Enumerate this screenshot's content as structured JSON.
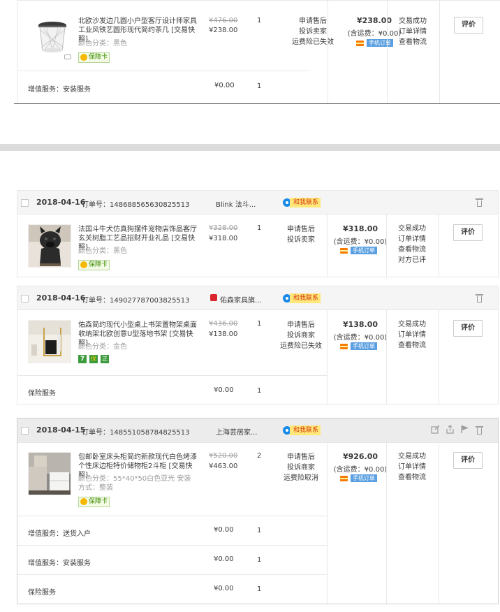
{
  "orders": [
    {
      "product": {
        "title": "北欧沙发边几圆小户型客厅设计师家具工业风铁艺圆形现代简约茶几 [交易快照]",
        "attr": "颜色分类：黑色",
        "badge": "保障卡",
        "orig_price": "¥476.00",
        "price": "¥238.00",
        "qty": "1",
        "actions": [
          "申请售后",
          "投诉卖家",
          "运费险已失效"
        ]
      },
      "total": "¥238.00",
      "shipping": "(含运费：¥0.00)",
      "mobile_tag": "手机订单",
      "status": [
        "交易成功",
        "订单详情",
        "查看物流"
      ],
      "button": "评价",
      "services": [
        {
          "label": "增值服务：安装服务",
          "price": "¥0.00",
          "qty": "1"
        }
      ]
    },
    {
      "date": "2018-04-16",
      "order_no": "订单号：148688565630825513",
      "shop": "Blink 法斗...",
      "contact": "和我联系",
      "product": {
        "title": "法国斗牛犬仿真狗摆件宠物店饰品客厅玄关树脂工艺品招财开业礼品 [交易快照]",
        "attr": "颜色分类：黑色",
        "badge": "保障卡",
        "orig_price": "¥328.00",
        "price": "¥318.00",
        "qty": "1",
        "actions": [
          "申请售后",
          "投诉卖家"
        ]
      },
      "total": "¥318.00",
      "shipping": "(含运费：¥0.00)",
      "mobile_tag": "手机订单",
      "status": [
        "交易成功",
        "订单详情",
        "查看物流",
        "对方已评"
      ],
      "button": "评价"
    },
    {
      "date": "2018-04-16",
      "order_no": "订单号：149027787003825513",
      "shop": "佑森家具旗...",
      "contact": "和我联系",
      "product": {
        "title": "佑森简约现代小型桌上书架置物架桌面收纳架北欧创意U型落地书架 [交易快照]",
        "attr": "颜色分类：金色",
        "badges": [
          "7",
          "保",
          "正"
        ],
        "orig_price": "¥436.00",
        "price": "¥138.00",
        "qty": "1",
        "actions": [
          "申请售后",
          "投诉商家",
          "运费险已失效"
        ]
      },
      "total": "¥138.00",
      "shipping": "(含运费：¥0.00)",
      "mobile_tag": "手机订单",
      "status": [
        "交易成功",
        "订单详情",
        "查看物流"
      ],
      "button": "评价",
      "services": [
        {
          "label": "保险服务",
          "price": "¥0.00",
          "qty": "1"
        }
      ]
    },
    {
      "date": "2018-04-15",
      "order_no": "订单号：148551058784825513",
      "shop": "上海芸居家...",
      "contact": "和我联系",
      "product": {
        "title": "包邮卧室床头柜简约新款现代白色烤漆个性床边柜特价储物柜2斗柜 [交易快照]",
        "attr": "颜色分类：55*40*50白色亚光  安装方式：整装",
        "badge": "保障卡",
        "orig_price": "¥520.00",
        "price": "¥463.00",
        "qty": "2",
        "actions": [
          "申请售后",
          "投诉商家",
          "运费险取消"
        ]
      },
      "total": "¥926.00",
      "shipping": "(含运费：¥0.00)",
      "mobile_tag": "手机订单",
      "status": [
        "交易成功",
        "订单详情",
        "查看物流"
      ],
      "button": "评价",
      "services": [
        {
          "label": "增值服务：送货入户",
          "price": "¥0.00",
          "qty": "1"
        },
        {
          "label": "增值服务：安装服务",
          "price": "¥0.00",
          "qty": "1"
        },
        {
          "label": "保险服务",
          "price": "¥0.00",
          "qty": "1"
        }
      ]
    }
  ]
}
